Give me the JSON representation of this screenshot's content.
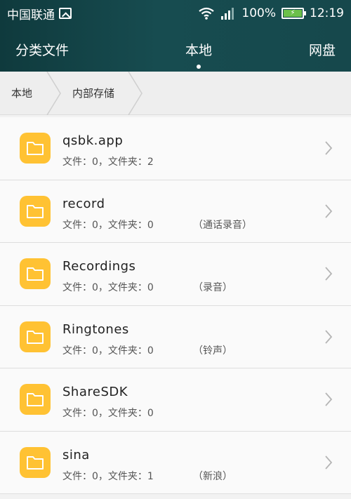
{
  "status": {
    "carrier": "中国联通",
    "battery": "100%",
    "time": "12:19"
  },
  "tabs": [
    {
      "label": "分类文件"
    },
    {
      "label": "本地"
    },
    {
      "label": "网盘"
    }
  ],
  "breadcrumb": [
    {
      "label": "本地"
    },
    {
      "label": "内部存储"
    }
  ],
  "files": [
    {
      "name": "qsbk.app",
      "meta": "文件：0，文件夹：2",
      "note": ""
    },
    {
      "name": "record",
      "meta": "文件：0，文件夹：0",
      "note": "（通话录音）"
    },
    {
      "name": "Recordings",
      "meta": "文件：0，文件夹：0",
      "note": "（录音）"
    },
    {
      "name": "Ringtones",
      "meta": "文件：0，文件夹：0",
      "note": "（铃声）"
    },
    {
      "name": "ShareSDK",
      "meta": "文件：0，文件夹：0",
      "note": ""
    },
    {
      "name": "sina",
      "meta": "文件：0，文件夹：1",
      "note": "（新浪）"
    }
  ]
}
